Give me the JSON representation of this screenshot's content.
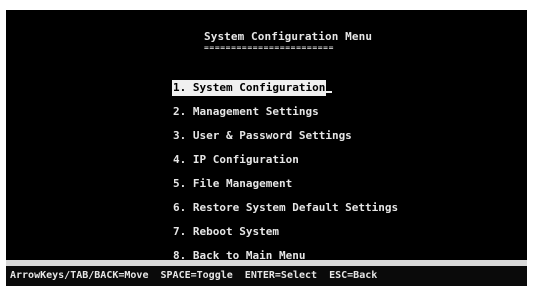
{
  "screen": {
    "title": "System Configuration Menu",
    "title_underline": "========================"
  },
  "menu": {
    "items": [
      {
        "label": "1. System Configuration",
        "selected": true
      },
      {
        "label": "2. Management Settings"
      },
      {
        "label": "3. User & Password Settings"
      },
      {
        "label": "4. IP Configuration"
      },
      {
        "label": "5. File Management"
      },
      {
        "label": "6. Restore System Default Settings"
      },
      {
        "label": "7. Reboot System"
      },
      {
        "label": "8. Back to Main Menu"
      }
    ]
  },
  "help_bar": {
    "text": "ArrowKeys/TAB/BACK=Move  SPACE=Toggle  ENTER=Select  ESC=Back"
  },
  "colors": {
    "background": "#000000",
    "text": "#e6e6e6",
    "selection_bg": "#f0f0f0",
    "selection_fg": "#000000"
  }
}
